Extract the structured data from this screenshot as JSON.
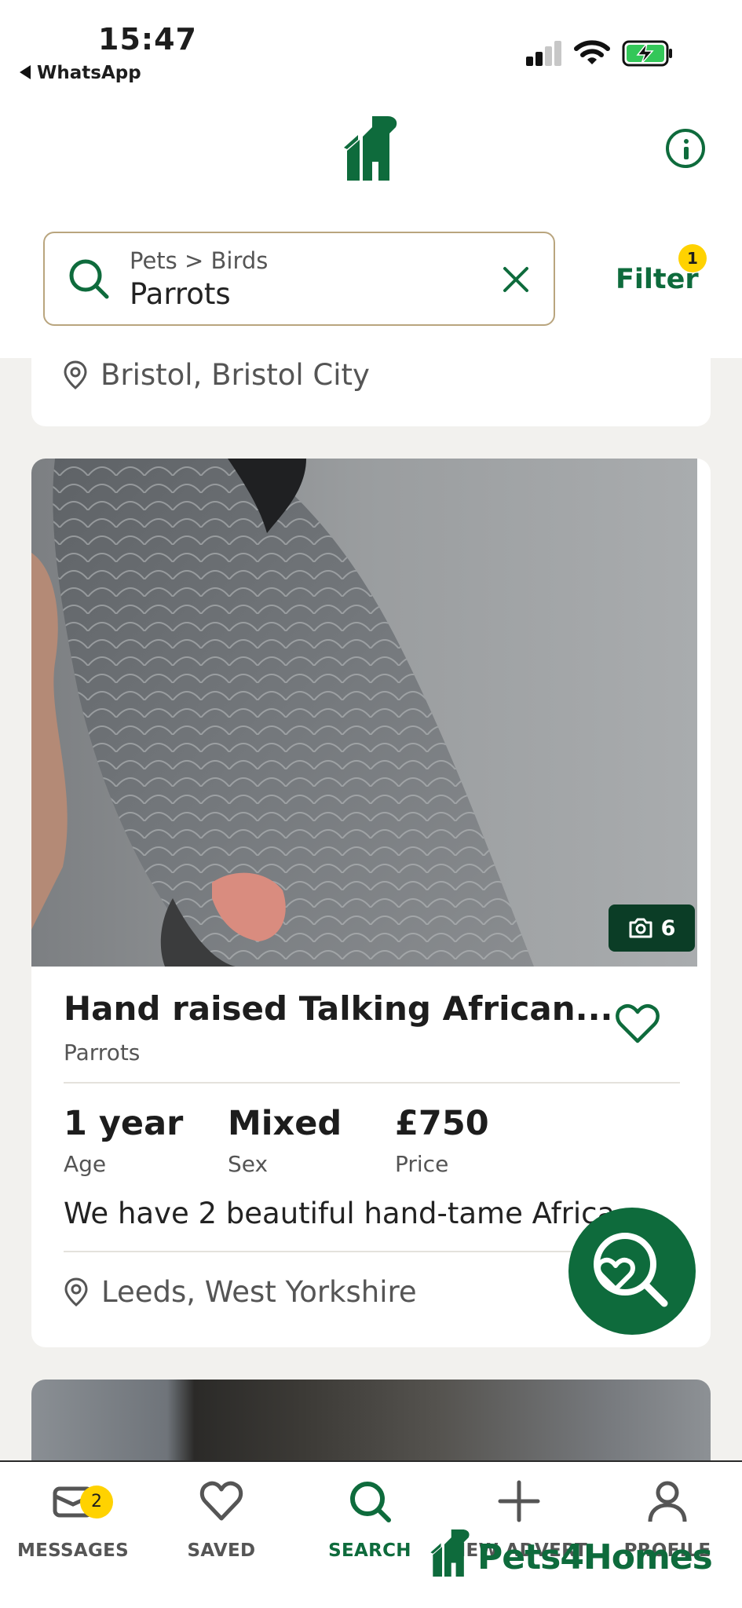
{
  "status_bar": {
    "time": "15:47",
    "back_app": "WhatsApp"
  },
  "header": {
    "logo": "pets4homes-house-logo",
    "info_icon": "info-icon"
  },
  "search": {
    "breadcrumb": "Pets > Birds",
    "query": "Parrots"
  },
  "filter": {
    "label": "Filter",
    "badge_count": "1"
  },
  "previous_listing": {
    "location": "Bristol, Bristol City"
  },
  "listing": {
    "photo_count": "6",
    "title": "Hand raised Talking African...",
    "category": "Parrots",
    "stats": [
      {
        "value": "1 year",
        "label": "Age"
      },
      {
        "value": "Mixed",
        "label": "Sex"
      },
      {
        "value": "£750",
        "label": "Price"
      }
    ],
    "description": "We have 2 beautiful hand-tame African Grey",
    "location": "Leeds, West Yorkshire"
  },
  "bottom_nav": {
    "items": [
      {
        "label": "MESSAGES",
        "icon": "envelope-icon",
        "badge": "2"
      },
      {
        "label": "SAVED",
        "icon": "heart-icon"
      },
      {
        "label": "SEARCH",
        "icon": "search-icon",
        "active": true
      },
      {
        "label": "NEW ADVERT",
        "icon": "plus-icon"
      },
      {
        "label": "PROFILE",
        "icon": "person-icon"
      }
    ]
  },
  "watermark": "Pets4Homes",
  "colors": {
    "brand_green": "#0e6b3c",
    "badge_yellow": "#ffd200",
    "search_border": "#b9a57e",
    "page_bg": "#f2f1ee"
  }
}
